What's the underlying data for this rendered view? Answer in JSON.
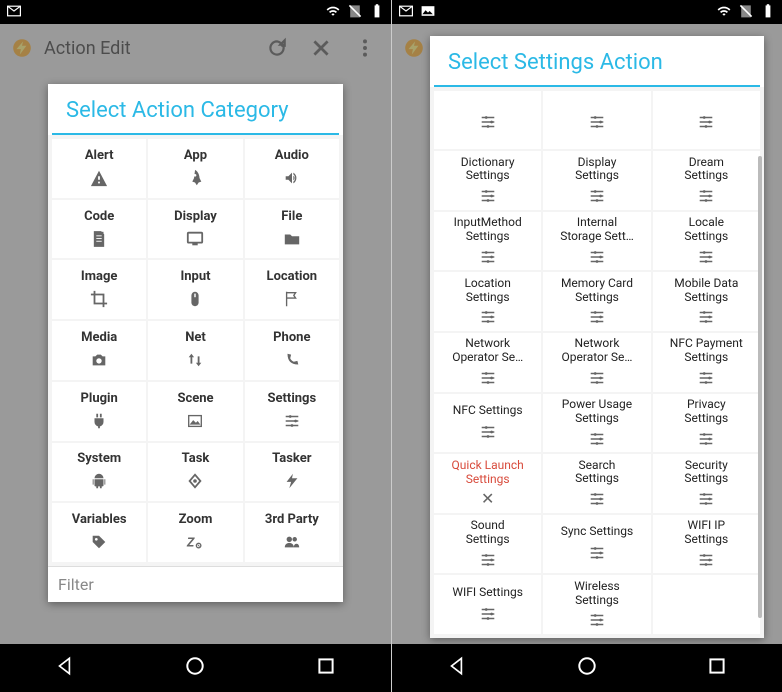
{
  "phone1": {
    "appbar_title": "Action Edit",
    "dialog_title": "Select Action Category",
    "filter_placeholder": "Filter",
    "cells": [
      {
        "label": "Alert",
        "icon": "warning-icon"
      },
      {
        "label": "App",
        "icon": "rocket-icon"
      },
      {
        "label": "Audio",
        "icon": "speaker-icon"
      },
      {
        "label": "Code",
        "icon": "document-icon"
      },
      {
        "label": "Display",
        "icon": "monitor-icon"
      },
      {
        "label": "File",
        "icon": "folder-icon"
      },
      {
        "label": "Image",
        "icon": "crop-icon"
      },
      {
        "label": "Input",
        "icon": "mouse-icon"
      },
      {
        "label": "Location",
        "icon": "flag-icon"
      },
      {
        "label": "Media",
        "icon": "camera-icon"
      },
      {
        "label": "Net",
        "icon": "updown-icon"
      },
      {
        "label": "Phone",
        "icon": "phone-icon"
      },
      {
        "label": "Plugin",
        "icon": "plug-icon"
      },
      {
        "label": "Scene",
        "icon": "picture-icon"
      },
      {
        "label": "Settings",
        "icon": "sliders-icon"
      },
      {
        "label": "System",
        "icon": "android-icon"
      },
      {
        "label": "Task",
        "icon": "diamond-icon"
      },
      {
        "label": "Tasker",
        "icon": "lightning-icon"
      },
      {
        "label": "Variables",
        "icon": "tag-icon"
      },
      {
        "label": "Zoom",
        "icon": "zoom-icon"
      },
      {
        "label": "3rd Party",
        "icon": "group-icon"
      }
    ]
  },
  "phone2": {
    "dialog_title": "Select Settings Action",
    "cells": [
      {
        "label": "",
        "icon": "sliders-icon"
      },
      {
        "label": "",
        "icon": "sliders-icon"
      },
      {
        "label": "",
        "icon": "sliders-icon"
      },
      {
        "label": "Dictionary\nSettings",
        "icon": "sliders-icon"
      },
      {
        "label": "Display\nSettings",
        "icon": "sliders-icon"
      },
      {
        "label": "Dream\nSettings",
        "icon": "sliders-icon"
      },
      {
        "label": "InputMethod\nSettings",
        "icon": "sliders-icon"
      },
      {
        "label": "Internal\nStorage Sett…",
        "icon": "sliders-icon"
      },
      {
        "label": "Locale\nSettings",
        "icon": "sliders-icon"
      },
      {
        "label": "Location\nSettings",
        "icon": "sliders-icon"
      },
      {
        "label": "Memory Card\nSettings",
        "icon": "sliders-icon"
      },
      {
        "label": "Mobile Data\nSettings",
        "icon": "sliders-icon"
      },
      {
        "label": "Network\nOperator Se…",
        "icon": "sliders-icon"
      },
      {
        "label": "Network\nOperator Se…",
        "icon": "sliders-icon"
      },
      {
        "label": "NFC Payment\nSettings",
        "icon": "sliders-icon"
      },
      {
        "label": "NFC Settings",
        "icon": "sliders-icon"
      },
      {
        "label": "Power Usage\nSettings",
        "icon": "sliders-icon"
      },
      {
        "label": "Privacy\nSettings",
        "icon": "sliders-icon"
      },
      {
        "label": "Quick Launch\nSettings",
        "icon": "x-icon",
        "danger": true
      },
      {
        "label": "Search\nSettings",
        "icon": "sliders-icon"
      },
      {
        "label": "Security\nSettings",
        "icon": "sliders-icon"
      },
      {
        "label": "Sound\nSettings",
        "icon": "sliders-icon"
      },
      {
        "label": "Sync Settings",
        "icon": "sliders-icon"
      },
      {
        "label": "WIFI IP\nSettings",
        "icon": "sliders-icon"
      },
      {
        "label": "WIFI Settings",
        "icon": "sliders-icon"
      },
      {
        "label": "Wireless\nSettings",
        "icon": "sliders-icon"
      },
      {
        "label": "",
        "icon": ""
      }
    ]
  }
}
